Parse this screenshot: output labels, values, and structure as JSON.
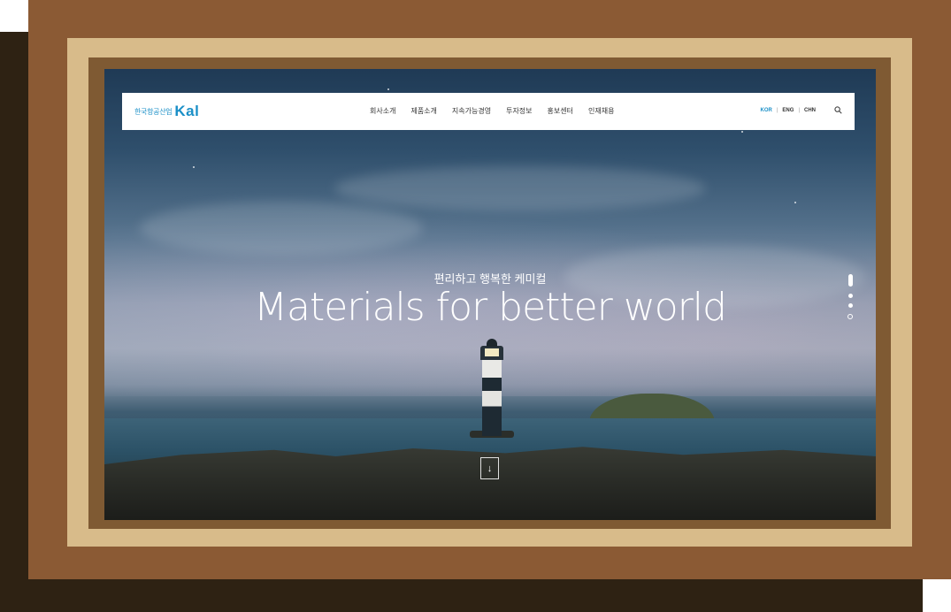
{
  "site": {
    "logo_korean": "한국항공산업",
    "logo_brand": "Kal"
  },
  "nav": {
    "items": [
      {
        "label": "회사소개"
      },
      {
        "label": "제품소개"
      },
      {
        "label": "지속가능경영"
      },
      {
        "label": "투자정보"
      },
      {
        "label": "홍보센터"
      },
      {
        "label": "인재채용"
      }
    ]
  },
  "languages": {
    "items": [
      "KOR",
      "ENG",
      "CHN"
    ],
    "active": "KOR"
  },
  "hero": {
    "subtitle": "편리하고 행복한 케미컬",
    "title": "Materials for better world"
  },
  "pager": {
    "count": 3,
    "active_index": 0
  },
  "icons": {
    "search": "search-icon",
    "scroll_down": "arrow-down-icon"
  },
  "colors": {
    "brand": "#1a8fc7",
    "frame_outer": "#8b5a34",
    "frame_mat": "#d8bb8a"
  }
}
